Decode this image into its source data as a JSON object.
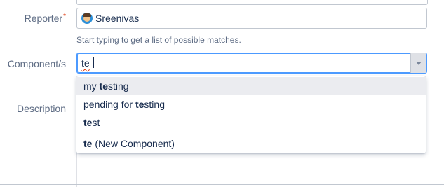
{
  "reporter": {
    "label": "Reporter",
    "required_marker": "*",
    "value": "Sreenivas",
    "hint": "Start typing to get a list of possible matches."
  },
  "component": {
    "label": "Component/s",
    "input_value": "te"
  },
  "description": {
    "label": "Description"
  },
  "suggestions": [
    {
      "pre": "my ",
      "match": "te",
      "post": "sting",
      "active": true
    },
    {
      "pre": "pending for ",
      "match": "te",
      "post": "sting",
      "active": false
    },
    {
      "pre": "",
      "match": "te",
      "post": "st",
      "active": false
    },
    {
      "pre": "",
      "match": "te",
      "post": " (New Component)",
      "active": false
    }
  ],
  "colors": {
    "label": "#5e6c84",
    "text": "#172b4d",
    "focus_border": "#4c9aff",
    "required": "#de350b",
    "highlight_row": "#ebecf0"
  }
}
